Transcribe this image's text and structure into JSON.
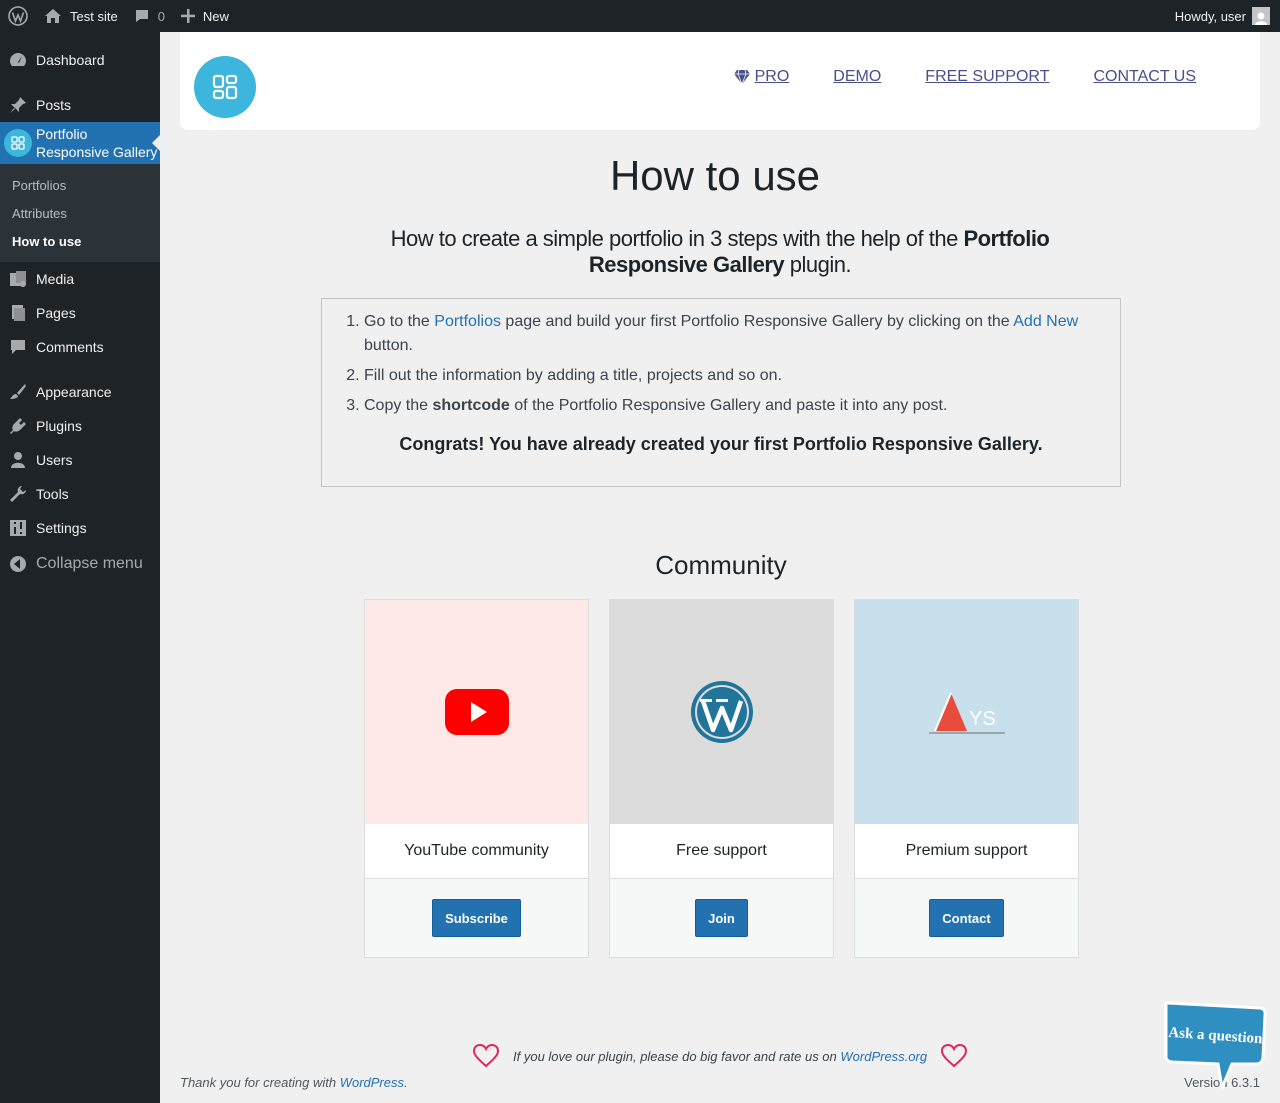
{
  "adminbar": {
    "site_name": "Test site",
    "comments_count": "0",
    "new_label": "New",
    "howdy": "Howdy, user"
  },
  "sidebar": {
    "items": [
      {
        "label": "Dashboard",
        "icon": "dashboard-icon"
      },
      {
        "label": "Posts",
        "icon": "pin-icon"
      },
      {
        "label": "Portfolio Responsive Gallery",
        "icon": "grid-icon"
      },
      {
        "label": "Media",
        "icon": "media-icon"
      },
      {
        "label": "Pages",
        "icon": "pages-icon"
      },
      {
        "label": "Comments",
        "icon": "comment-icon"
      },
      {
        "label": "Appearance",
        "icon": "brush-icon"
      },
      {
        "label": "Plugins",
        "icon": "plug-icon"
      },
      {
        "label": "Users",
        "icon": "user-icon"
      },
      {
        "label": "Tools",
        "icon": "wrench-icon"
      },
      {
        "label": "Settings",
        "icon": "sliders-icon"
      }
    ],
    "submenu": [
      "Portfolios",
      "Attributes",
      "How to use"
    ],
    "collapse_label": "Collapse menu"
  },
  "topbar": {
    "links": [
      "PRO",
      "DEMO",
      "FREE SUPPORT",
      "CONTACT US"
    ]
  },
  "main": {
    "title": "How to use",
    "subtitle_pre": "How to create a simple portfolio in 3 steps with the help of the ",
    "subtitle_bold": "Portfolio Responsive Gallery",
    "subtitle_post": " plugin.",
    "step1_a": "Go to the ",
    "step1_link1": "Portfolios",
    "step1_b": " page and build your first Portfolio Responsive Gallery by clicking on the ",
    "step1_link2": "Add New",
    "step1_c": " button.",
    "step2": "Fill out the information by adding a title, projects and so on.",
    "step3_a": "Copy the ",
    "step3_bold": "shortcode",
    "step3_b": " of the Portfolio Responsive Gallery and paste it into any post.",
    "congrats": "Congrats! You have already created your first Portfolio Responsive Gallery."
  },
  "community": {
    "title": "Community",
    "cards": [
      {
        "title": "YouTube community",
        "button": "Subscribe",
        "bg": "#ffe8e8"
      },
      {
        "title": "Free support",
        "button": "Join",
        "bg": "#dcdcdc"
      },
      {
        "title": "Premium support",
        "button": "Contact",
        "bg": "#c8e0ec"
      }
    ]
  },
  "rate": {
    "text": "If you love our plugin, please do big favor and rate us on ",
    "link": "WordPress.org"
  },
  "footer": {
    "left_text": "Thank you for creating with ",
    "left_link": "WordPress",
    "left_end": ".",
    "version": "Version 6.3.1"
  },
  "ask_widget": "Ask a question",
  "colors": {
    "accent": "#2271b1",
    "admin_bg": "#1d2327",
    "logo_bg": "#3cb6dd",
    "link_nav": "#494f8a"
  }
}
